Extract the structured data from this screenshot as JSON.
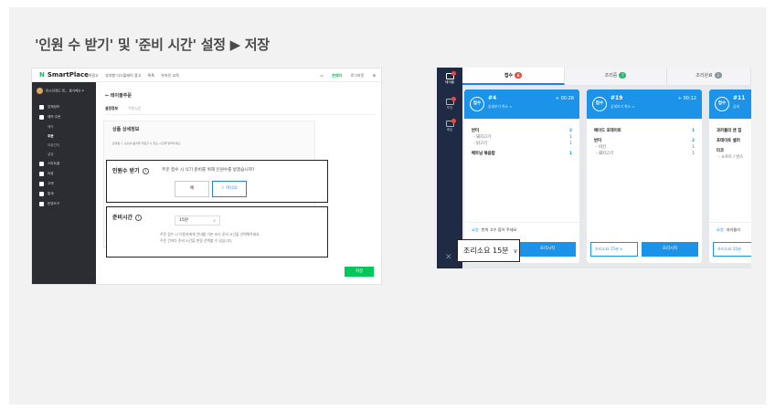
{
  "headline": "'인원 수 받기' 및 '준비 시간' 설정 ▶ 저장",
  "smartplace": {
    "logo_n": "N",
    "logo_text": "SmartPlace",
    "nav": [
      "검색광고",
      "성과형 디스플레이 광고",
      "톡톡",
      "온라인 교육"
    ],
    "top_right": [
      "",
      "판매자",
      "로그아웃"
    ],
    "profile_name": "마시모레드 레... 음식메뉴 ▾",
    "menu": [
      {
        "label": "업체정보",
        "subs": []
      },
      {
        "label": "예약·주문",
        "subs": [
          "예약",
          "주문",
          "리뷰관리",
          "설정"
        ]
      },
      {
        "label": "스마트콜",
        "subs": []
      },
      {
        "label": "리뷰",
        "subs": []
      },
      {
        "label": "고객",
        "subs": []
      },
      {
        "label": "통계",
        "subs": []
      },
      {
        "label": "운영도구",
        "subs": []
      }
    ],
    "active_sub": "주문",
    "page_title": "← 테이블주문",
    "tabs": [
      "설정정보",
      "주문시간"
    ],
    "section_title": "상품 상세정보",
    "option_text": "운영중 ⓘ      손님이 음식을 주문할 수 있는 시간을 알려주세요.",
    "headcount": {
      "label": "인원수 받기",
      "question": "주문 접수 시 식기 준비를 위해 인원수를 받겠습니까?",
      "yes": "예",
      "no": "✓ 아니오"
    },
    "prep": {
      "label": "준비시간",
      "value": "15분",
      "hint_1": "주문 접수 시 이용자에게 안내할 기본 조리 준비 시간을 선택해주세요.",
      "hint_2": "주문 건마다 준비 시간을 변경 선택할 수 있습니다."
    },
    "save": "저장"
  },
  "orderboard": {
    "sidebar": [
      {
        "label": "테이블",
        "active": true
      },
      {
        "label": "포장",
        "active": false
      },
      {
        "label": "배달",
        "active": false
      }
    ],
    "close": "✕",
    "tabs": [
      {
        "label": "접수",
        "count": "6",
        "color": "#e84c3d"
      },
      {
        "label": "조리중",
        "count": "7",
        "color": "#2bb673"
      },
      {
        "label": "조리완료",
        "count": "3",
        "color": "#8a8f99"
      }
    ],
    "cards": [
      {
        "status": "접수",
        "number": "#4",
        "sub": "상세보기 취소 >",
        "time": "+ 00:28",
        "lines": [
          {
            "name": "반미",
            "qty": "2",
            "kind": "main"
          },
          {
            "name": "- 돼지고기",
            "qty": "1",
            "kind": "opt"
          },
          {
            "name": "- 닭고기",
            "qty": "1",
            "kind": "opt"
          },
          {
            "name": "베트남 볶음밥",
            "qty": "1",
            "kind": "main",
            "gap": true
          }
        ],
        "memo_label": "요청",
        "memo": "반미 고수 많이 주세요",
        "cook_select": "조리소요 15분 ∨",
        "cook_button": "조리시작"
      },
      {
        "status": "접수",
        "number": "#19",
        "sub": "상세보기 취소 >",
        "time": "+ 00:12",
        "lines": [
          {
            "name": "페이드 포테이토",
            "qty": "1",
            "kind": "main"
          },
          {
            "name": "반미",
            "qty": "2",
            "kind": "main",
            "gap": true
          },
          {
            "name": "- 비건",
            "qty": "1",
            "kind": "opt"
          },
          {
            "name": "- 돼지고기",
            "qty": "1",
            "kind": "opt"
          }
        ],
        "memo_label": "",
        "memo": "",
        "cook_select": "조리소요 15분 ∨",
        "cook_button": "조리시작"
      },
      {
        "status": "접수",
        "number": "#11",
        "sub": "상세",
        "time": "",
        "lines": [
          {
            "name": "과카몰리 앤 칩",
            "qty": "",
            "kind": "main"
          },
          {
            "name": "포테이토 샐러",
            "qty": "",
            "kind": "main",
            "gap": true
          },
          {
            "name": "타코",
            "qty": "",
            "kind": "main",
            "gap": true
          },
          {
            "name": "- 소프트 / 반스",
            "qty": "",
            "kind": "opt"
          }
        ],
        "memo_label": "요청",
        "memo": "과카몰리",
        "cook_select": "조리소요 15분",
        "cook_button": ""
      }
    ],
    "highlight_select": "조리소요 15분",
    "highlight_chev": "∨"
  }
}
